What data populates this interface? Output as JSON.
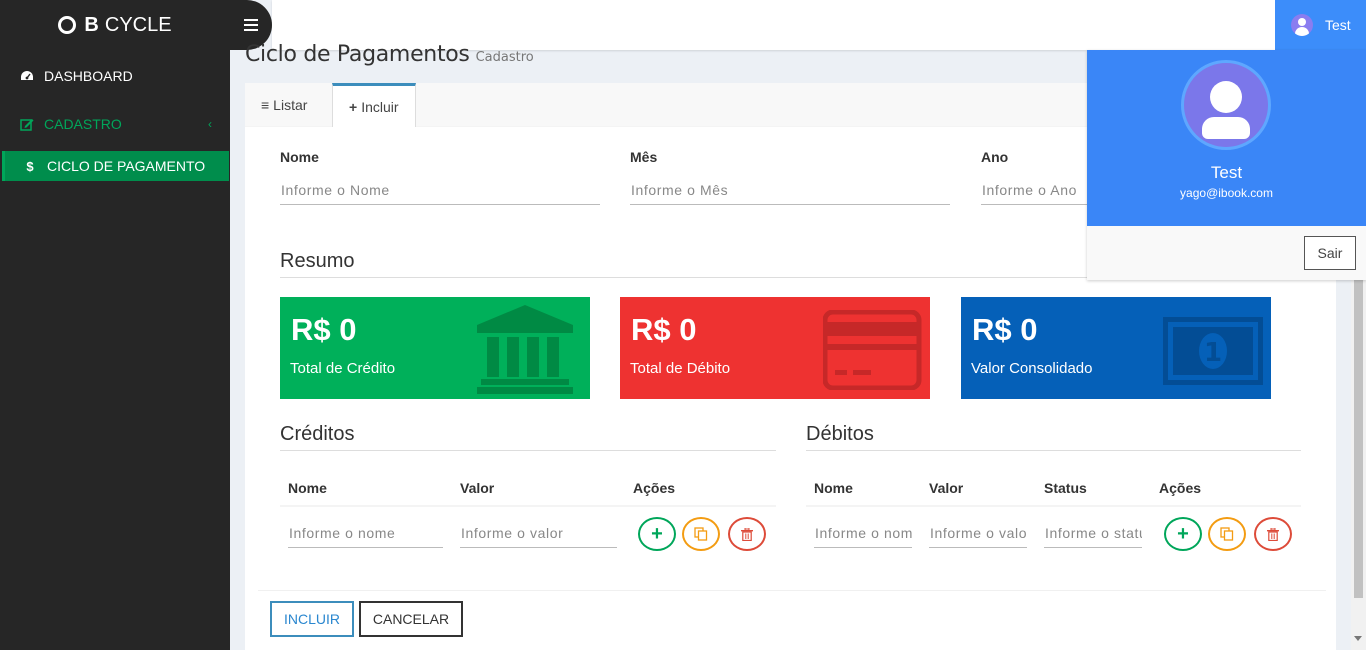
{
  "sidebar": {
    "brand_strong": "B",
    "brand_text": "CYCLE",
    "items": [
      {
        "label": "DASHBOARD",
        "icon": "dashboard-icon"
      },
      {
        "label": "CADASTRO",
        "icon": "edit-icon"
      },
      {
        "label": "CICLO DE PAGAMENTO",
        "icon": "dollar-icon"
      }
    ]
  },
  "topbar": {
    "user_name": "Test"
  },
  "page": {
    "title": "Ciclo de Pagamentos",
    "subtitle": "Cadastro"
  },
  "tabs": [
    {
      "label": "Listar",
      "icon": "list-icon"
    },
    {
      "label": "Incluir",
      "icon": "plus-icon"
    }
  ],
  "form": {
    "name_label": "Nome",
    "name_placeholder": "Informe o Nome",
    "month_label": "Mês",
    "month_placeholder": "Informe o Mês",
    "year_label": "Ano",
    "year_placeholder": "Informe o Ano"
  },
  "summary": {
    "title": "Resumo",
    "cards": [
      {
        "value": "R$ 0",
        "label": "Total de Crédito",
        "color": "#00a65a",
        "icon": "bank-icon"
      },
      {
        "value": "R$ 0",
        "label": "Total de Débito",
        "color": "#ef3232",
        "icon": "credit-card-icon"
      },
      {
        "value": "R$ 0",
        "label": "Valor Consolidado",
        "color": "#0a5fb4",
        "icon": "money-icon"
      }
    ]
  },
  "credits": {
    "title": "Créditos",
    "headers": [
      "Nome",
      "Valor",
      "Ações"
    ],
    "name_placeholder": "Informe o nome",
    "value_placeholder": "Informe o valor"
  },
  "debits": {
    "title": "Débitos",
    "headers": [
      "Nome",
      "Valor",
      "Status",
      "Ações"
    ],
    "name_placeholder": "Informe o nome",
    "value_placeholder": "Informe o valor",
    "status_placeholder": "Informe o status"
  },
  "actions": {
    "include_label": "INCLUIR",
    "cancel_label": "CANCELAR"
  },
  "user_dropdown": {
    "name": "Test",
    "email": "yago@ibook.com",
    "logout_label": "Sair"
  }
}
